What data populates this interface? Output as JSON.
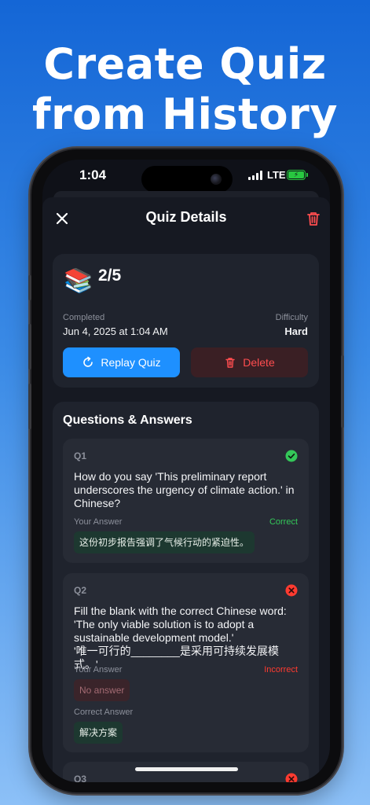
{
  "promo": {
    "headline_line1": "Create Quiz",
    "headline_line2": "from History"
  },
  "status_bar": {
    "time": "1:04",
    "network": "LTE"
  },
  "nav": {
    "title": "Quiz Details"
  },
  "summary": {
    "icon": "books-emoji",
    "emoji": "📚",
    "score": "2/5",
    "completed_label": "Completed",
    "completed_value": "Jun 4, 2025 at 1:04 AM",
    "difficulty_label": "Difficulty",
    "difficulty_value": "Hard",
    "replay_label": "Replay Quiz",
    "delete_label": "Delete"
  },
  "qa": {
    "title": "Questions & Answers",
    "questions": [
      {
        "number": "Q1",
        "status": "correct",
        "text": "How do you say 'This preliminary report underscores the urgency of climate action.' in Chinese?",
        "your_answer_label": "Your Answer",
        "result": "Correct",
        "your_answer": "这份初步报告强调了气候行动的紧迫性。"
      },
      {
        "number": "Q2",
        "status": "incorrect",
        "text_line1": "Fill the blank with the correct Chinese word:",
        "text_line2": "'The only viable solution is to adopt a sustainable development model.'",
        "text_line3": "'唯一可行的________是采用可持续发展模式。'",
        "your_answer_label": "Your Answer",
        "result": "Incorrect",
        "your_answer": "No answer",
        "correct_answer_label": "Correct Answer",
        "correct_answer": "解决方案"
      },
      {
        "number": "Q3",
        "status": "incorrect"
      }
    ]
  },
  "colors": {
    "accent_blue": "#1e90ff",
    "danger_red": "#ff4d4f",
    "success_green": "#34c759",
    "background_dark": "#161922"
  }
}
